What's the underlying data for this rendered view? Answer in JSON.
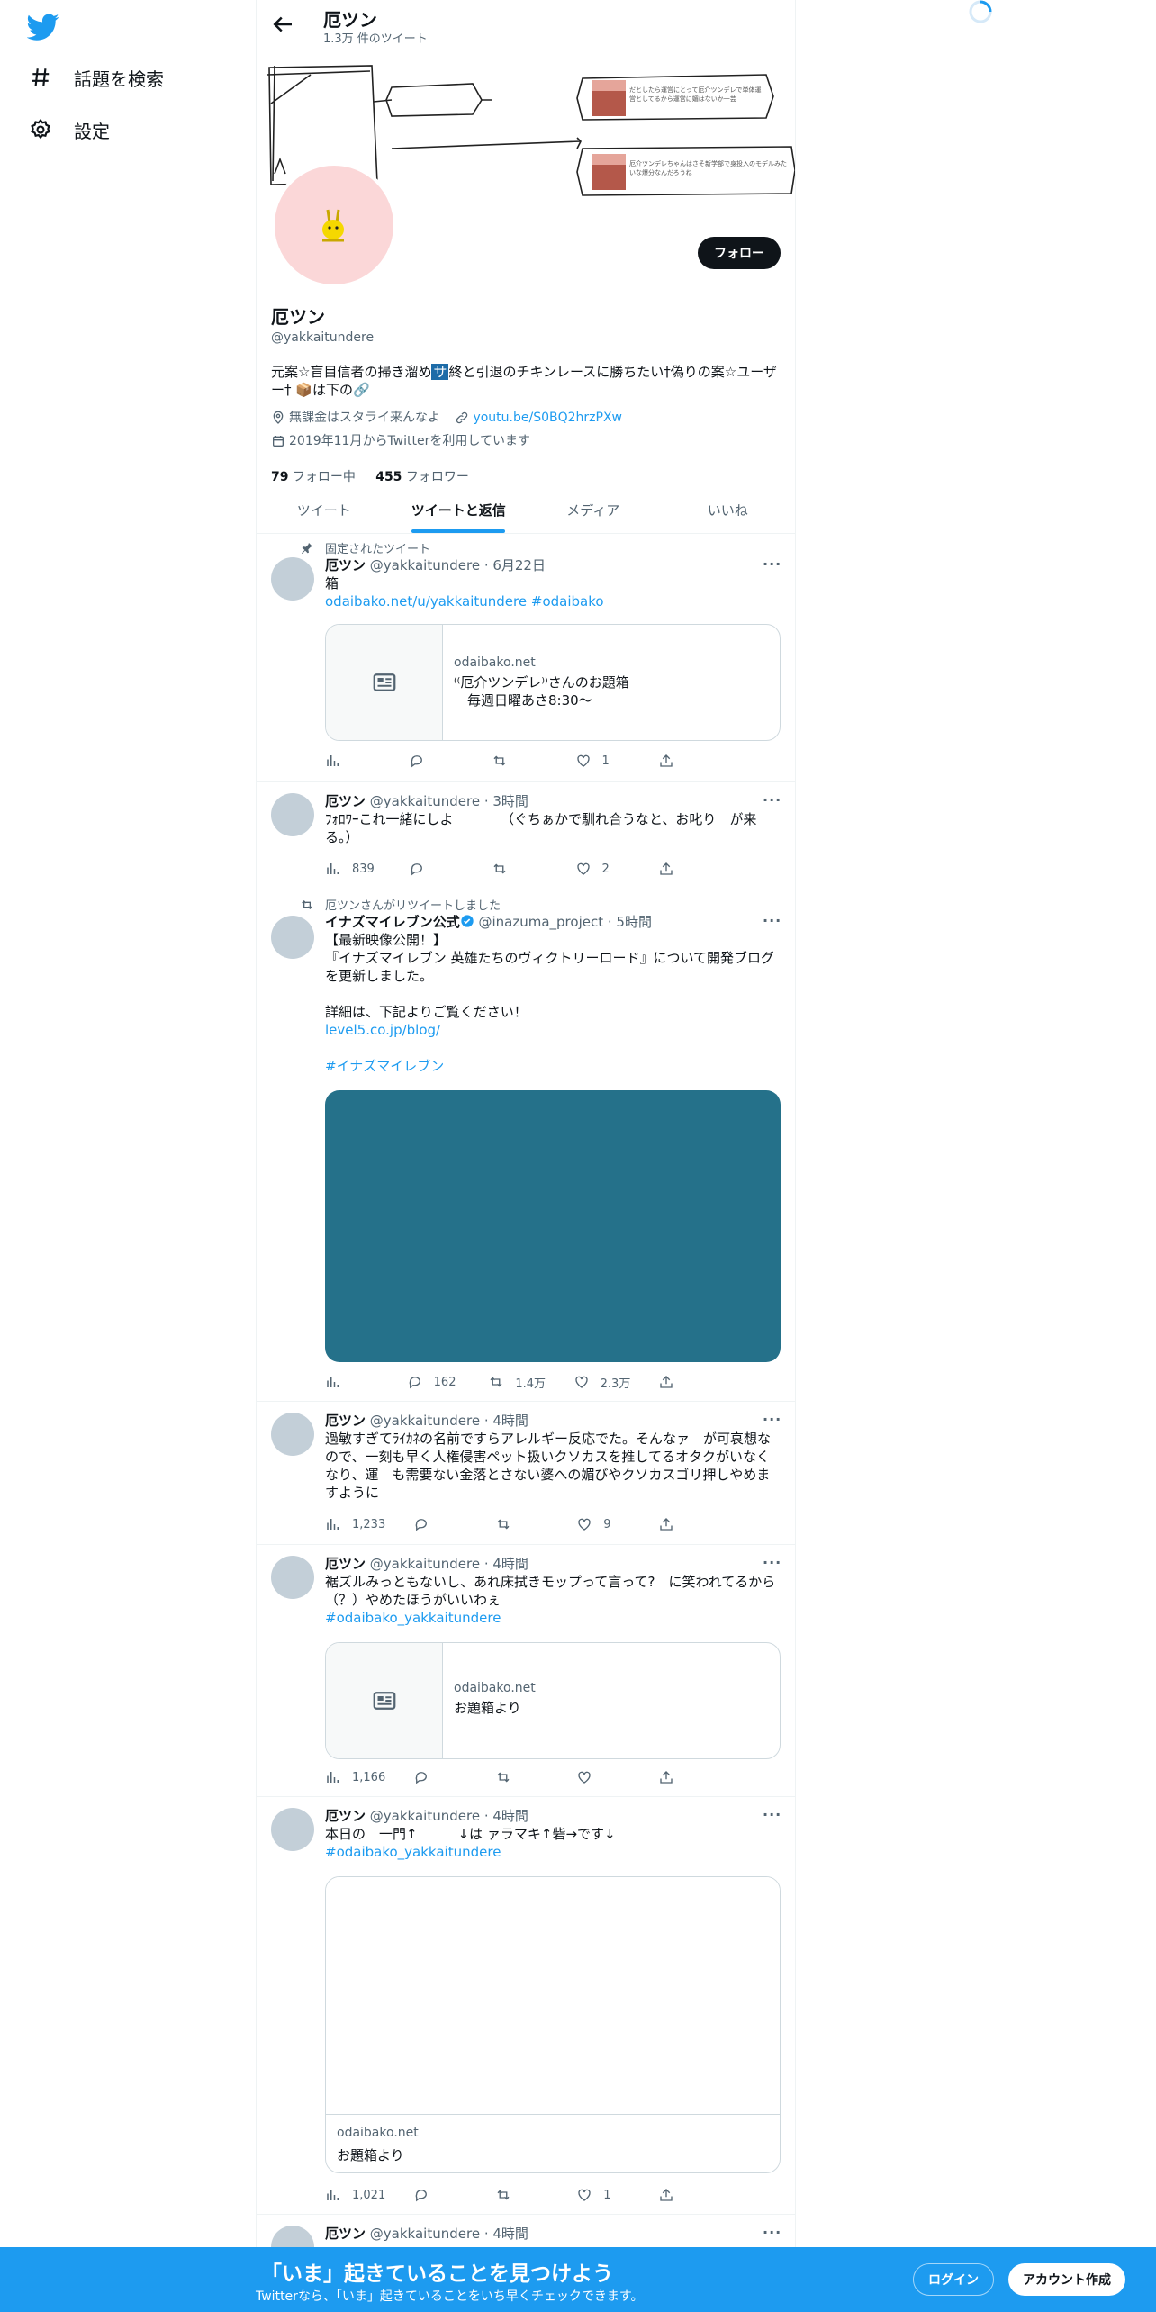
{
  "nav": {
    "explore_label": "話題を検索",
    "settings_label": "設定"
  },
  "header": {
    "title": "厄ツン",
    "tweet_count": "1.3万 件のツイート"
  },
  "banner": {
    "note1": "だとしたら運営にとって厄介ツンデレで単体運営としてるから運営に媚はないか一芸",
    "note2": "厄介ツンデレちゃんはさそ新学部で身投入のモデルみたいな爆分なんだろうね"
  },
  "profile": {
    "follow_label": "フォロー",
    "name": "厄ツン",
    "handle": "@yakkaitundere",
    "bio_a": "元案☆盲目信者の掃き溜め",
    "bio_hl": "サ",
    "bio_b": "終と引退のチキンレースに勝ちたい†偽りの案☆ユーザー† 📦は下の🔗",
    "location": "無課金はスタライ来んなよ",
    "url": "youtu.be/S0BQ2hrzPXw",
    "joined": "2019年11月からTwitterを利用しています",
    "following_count": "79",
    "following_label": "フォロー中",
    "followers_count": "455",
    "followers_label": "フォロワー"
  },
  "tabs": [
    "ツイート",
    "ツイートと返信",
    "メディア",
    "いいね"
  ],
  "tweets": [
    {
      "context": "固定されたツイート",
      "name": "厄ツン",
      "meta": "@yakkaitundere · 6月22日",
      "text": "箱",
      "link1": "odaibako.net/u/yakkaitundere",
      "link2": "#odaibako",
      "card_domain": "odaibako.net",
      "card_title": "⁽⁽厄介ツンデレ⁾⁾さんのお題箱\n　毎週日曜あさ8:30〜",
      "views": "",
      "replies": "",
      "retweets": "",
      "likes": "1"
    },
    {
      "name": "厄ツン",
      "meta": "@yakkaitundere · 3時間",
      "text": "ﾌｫﾛﾜｰこれ一緒にしよ　　　　（ぐちぁかで馴れ合うなと、お叱り　が来る。）",
      "views": "839",
      "replies": "",
      "retweets": "",
      "likes": "2"
    },
    {
      "context": "厄ツンさんがリツイートしました",
      "name": "イナズマイレブン公式",
      "meta": "@inazuma_project · 5時間",
      "text": "【最新映像公開！】\n『イナズマイレブン 英雄たちのヴィクトリーロード』について開発ブログを更新しました。\n\n詳細は、下記よりご覧ください！",
      "link1": "level5.co.jp/blog/",
      "link2": "#イナズマイレブン",
      "views": "",
      "replies": "162",
      "retweets": "1.4万",
      "likes": "2.3万",
      "media_color": "#25718a"
    },
    {
      "name": "厄ツン",
      "meta": "@yakkaitundere · 4時間",
      "text": "過敏すぎてﾗｲｶﾈの名前ですらアレルギー反応でた。そんなァ　が可哀想なので、一刻も早く人権侵害ペット扱いクソカスを推してるオタクがいなくなり、運　も需要ない金落とさない婆への媚びやクソカスゴリ押しやめますように",
      "views": "1,233",
      "replies": "",
      "retweets": "",
      "likes": "9"
    },
    {
      "name": "厄ツン",
      "meta": "@yakkaitundere · 4時間",
      "text": "裾ズルみっともないし、あれ床拭きモップって言って?　に笑われてるから（？）やめたほうがいいわぇ",
      "link1": "#odaibako_yakkaitundere",
      "card_domain": "odaibako.net",
      "card_title": "お題箱より",
      "views": "1,166",
      "replies": "",
      "retweets": "",
      "likes": ""
    },
    {
      "name": "厄ツン",
      "meta": "@yakkaitundere · 4時間",
      "text": "本日の　一門↑　　　↓は ァラマキ↑砦→です↓",
      "link1": "#odaibako_yakkaitundere",
      "card_domain": "odaibako.net",
      "card_title": "お題箱より",
      "views": "1,021",
      "replies": "",
      "retweets": "",
      "likes": "1"
    },
    {
      "name": "厄ツン",
      "meta": "@yakkaitundere · 4時間"
    }
  ],
  "bottom_bar": {
    "title": "「いま」起きていることを見つけよう",
    "subtitle": "Twitterなら、「いま」起きていることをいち早くチェックできます。",
    "login_label": "ログイン",
    "signup_label": "アカウント作成"
  },
  "colors": {
    "accent": "#1d9bf0",
    "avatar_bg": "#fbd7d8",
    "bottom_bar": "#1d9bf0"
  }
}
